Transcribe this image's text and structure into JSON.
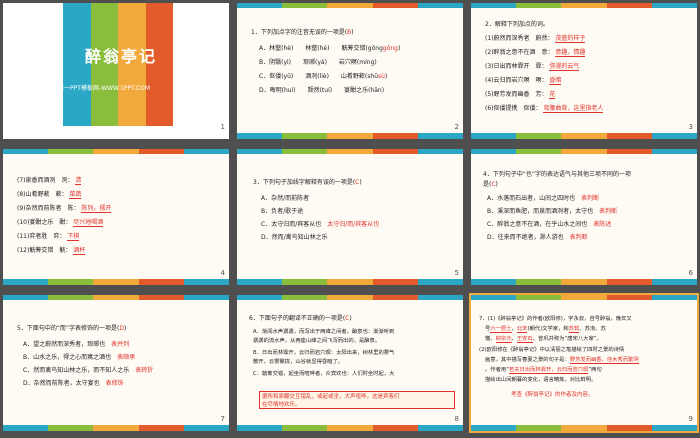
{
  "colors": {
    "bg": "#4f4f4f",
    "slide": "#fdfbf4",
    "red": "#e0312b",
    "stripe": [
      "#2aa7c5",
      "#8bbd3d",
      "#f2a93b",
      "#e25b2b"
    ]
  },
  "slides": [
    {
      "num": "1",
      "title": "醉翁亭记",
      "subtitle": "第一PPT模板网-WWW.1PPT.COM"
    },
    {
      "num": "2",
      "lines": [
        "1．下列加点字的注音无误的一项是(",
        "B",
        ")",
        "A．林壑(hè)　　林壑(hè)　　觥筹交错(gōng",
        "gōng",
        ")",
        "B．阴翳(yì)　　琅琊(yá)　　岩穴暝(míng)",
        "C．伛偻(yǔ)　　酒洌(liè)　　山肴野蔌(shū",
        "sù",
        ")",
        "D．晦明(huì)　　颓然(tuí)　　宴酣之乐(hān)"
      ]
    },
    {
      "num": "3",
      "lines": [
        "2．解释下列加点的词。",
        "(1)蔚然而深秀者　蔚然：",
        "茂盛的样子",
        "(2)醉翁之意不在酒　意：",
        "意趣，情趣",
        "(3)日出而林霏开　霏：",
        "弥漫的云气",
        "(4)云归而岩穴暝　暝：",
        "昏暗",
        "(5)野芳发而幽香　芳：",
        "花",
        "(6)伛偻提携　伛偻：",
        "弯腰曲背，这里指老人"
      ]
    },
    {
      "num": "4",
      "lines": [
        "(7)泉香而酒洌　洌：",
        "清",
        "(8)山肴野蔌　蔌：",
        "菜蔬",
        "(9)杂然而前陈者　陈：",
        "陈列，摆开",
        "(10)宴酣之乐　酣：",
        "尽兴地喝酒",
        "(11)弈者胜　弈：",
        "下棋",
        "(12)觥筹交错　觥：",
        "酒杯"
      ]
    },
    {
      "num": "5",
      "lines": [
        "3．下列句子加线字解释有误的一项是(",
        "C",
        ")",
        "A．杂然/而前陈者",
        "B．负者/歌于途",
        "C．太守归而/宾客从也",
        "太守归/而/宾客从也",
        "D．然而/禽鸟知山林之乐"
      ]
    },
    {
      "num": "6",
      "lines": [
        "4．下列句子中“也”字的表达语气与其他三项不同的一项",
        "是(",
        "C",
        ")",
        "A．水落而石出者，山间之四时也",
        "表判断",
        "B．溪深而鱼肥，而泉而酒洌者，太守也",
        "表判断",
        "C．醉翁之意不在酒，在乎山水之间也",
        "表陈述",
        "D．往来而不绝者，滁人游也",
        "表判断"
      ]
    },
    {
      "num": "7",
      "lines": [
        "5．下面句中的“而”字表修饰的一项是(",
        "D",
        ")",
        "A．望之蔚然而深秀者，琅琊也",
        "表并列",
        "B．山水之乐，得之心而寓之酒也",
        "表顺承",
        "C．然而禽鸟知山林之乐，而不知人之乐",
        "表转折",
        "D．杂然而前陈者，太守宴也",
        "表修饰"
      ]
    },
    {
      "num": "8",
      "lines": [
        "6．下面句子的翻译不正确的一项是(",
        "C",
        ")",
        "A．渐闻水声潺潺，而泻出于两峰之间者，酿泉也：渐渐听到",
        "潺潺的流水声，从两座山峰之间飞泻而出的，是酿泉。",
        "B．日出而林霏开，云归而岩穴暝：太阳出来，树林里的雾气",
        "散开，云雾聚拢，山谷就显得昏暗了。",
        "C．觥筹交错，起坐而喧哗者，众宾欢也：人们时坐时起，大",
        "据所和原翻交互错乱，或起或坐，大声喧哗，这是宾客们",
        "在尽情地欢乐。"
      ]
    },
    {
      "num": "9",
      "lines": [
        "7．(1)《醉翁亭记》的作者(欧阳修)，字永叔，自号醉翁，晚年又",
        "号",
        "六一居士",
        "，",
        "北宋",
        "(朝代)文学家，和",
        "苏轼",
        "、苏洵、苏",
        "辙、",
        "柳宗元",
        "、",
        "王安石",
        "、曾巩并称为“唐宋八大家”。",
        "(2)欧阳修在《醉翁亭记》中以清丽之笔描绘了四时之景的诗情",
        "画意，其中描写春夏之景的句子是：",
        "野芳发而幽香，佳木秀而繁阴",
        "。作者用“",
        "若夫日出而林霏开，云归而岩穴暝",
        "”两句",
        "描绘出山间朝暮的变化，语言精炼，对比鲜明。",
        "考查《醉翁亭记》的作者及内容。"
      ]
    }
  ]
}
